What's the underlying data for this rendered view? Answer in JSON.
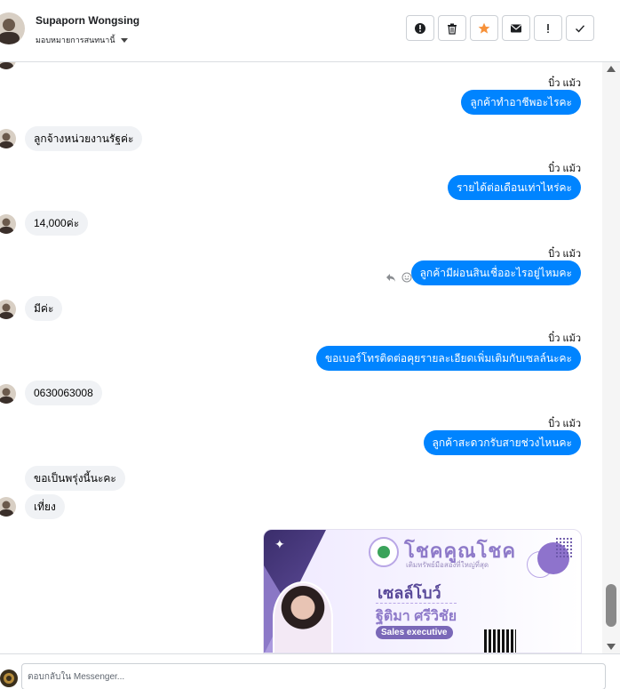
{
  "header": {
    "name": "Supaporn Wongsing",
    "assign_label": "มอบหมายการสนทนานี้",
    "actions": [
      {
        "icon": "alert-circle-icon",
        "name": "mark-spam-button"
      },
      {
        "icon": "trash-icon",
        "name": "delete-button"
      },
      {
        "icon": "star-icon",
        "name": "star-button"
      },
      {
        "icon": "envelope-icon",
        "name": "mark-unread-button"
      },
      {
        "icon": "exclamation-icon",
        "name": "follow-up-button"
      },
      {
        "icon": "check-icon",
        "name": "done-button"
      }
    ],
    "star_color": "#f7923a"
  },
  "messages": [
    {
      "dir": "out",
      "sender": "บิ๋ว แม้ว",
      "text": "ลูกค้าทำอาชีพอะไรคะ"
    },
    {
      "dir": "in",
      "text": "ลูกจ้างหน่วยงานรัฐค่ะ"
    },
    {
      "dir": "out",
      "sender": "บิ๋ว แม้ว",
      "text": "รายได้ต่อเดือนเท่าไหร่คะ"
    },
    {
      "dir": "in",
      "text": "14,000ค่ะ"
    },
    {
      "dir": "out",
      "sender": "บิ๋ว แม้ว",
      "text": "ลูกค้ามีผ่อนสินเชื่ออะไรอยู่ไหมคะ"
    },
    {
      "dir": "in",
      "text": "มีค่ะ"
    },
    {
      "dir": "out",
      "sender": "บิ๋ว แม้ว",
      "text": "ขอเบอร์โทรติดต่อคุยรายละเอียดเพิ่มเติมกับเซลล์นะคะ"
    },
    {
      "dir": "in",
      "text": "0630063008"
    },
    {
      "dir": "out",
      "sender": "บิ๋ว แม้ว",
      "text": "ลูกค้าสะดวกรับสายช่วงไหนคะ"
    },
    {
      "dir": "in",
      "text": "ขอเป็นพรุ่งนี้นะคะ"
    },
    {
      "dir": "in",
      "text": "เที่ยง"
    }
  ],
  "card": {
    "brand": "โชคคูณโชค",
    "tagline": "เติมทรัพย์มือสองที่ใหญ่ที่สุด",
    "title": "เซลล์โบว์",
    "person_name": "ฐิติมา ศรีวิชัย",
    "role": "Sales executive"
  },
  "footer": {
    "reply_placeholder": "ตอบกลับใน Messenger..."
  },
  "colors": {
    "outgoing_bubble": "#0084ff",
    "incoming_bubble": "#f0f2f5"
  }
}
